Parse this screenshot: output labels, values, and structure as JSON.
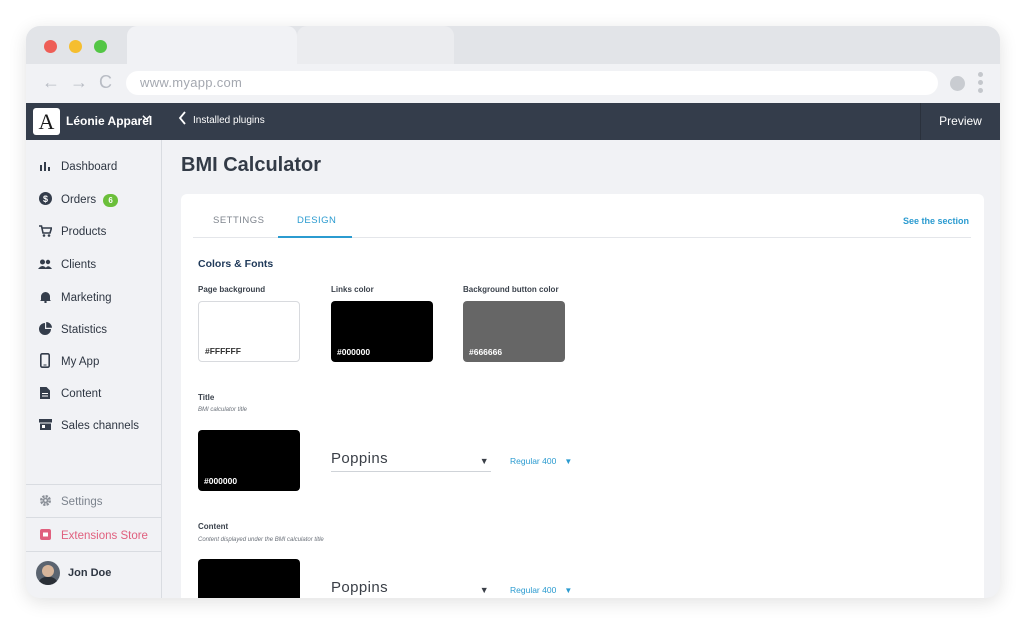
{
  "browser": {
    "url": "www.myapp.com",
    "back_icon": "←",
    "forward_icon": "→",
    "reload_icon": "C"
  },
  "topbar": {
    "logo_letter": "A",
    "store_name": "Léonie Apparel",
    "back_label": "Installed plugins",
    "preview_label": "Preview"
  },
  "sidebar": {
    "items": [
      {
        "label": "Dashboard",
        "icon": "bar-chart-icon"
      },
      {
        "label": "Orders",
        "icon": "dollar-circle-icon",
        "badge": "6"
      },
      {
        "label": "Products",
        "icon": "cart-icon"
      },
      {
        "label": "Clients",
        "icon": "people-icon"
      },
      {
        "label": "Marketing",
        "icon": "bell-icon"
      },
      {
        "label": "Statistics",
        "icon": "pie-chart-icon"
      },
      {
        "label": "My App",
        "icon": "phone-icon"
      },
      {
        "label": "Content",
        "icon": "document-icon"
      },
      {
        "label": "Sales channels",
        "icon": "store-icon"
      }
    ],
    "settings_label": "Settings",
    "extensions_label": "Extensions Store",
    "user_name": "Jon Doe"
  },
  "page": {
    "title": "BMI Calculator",
    "tabs": [
      "SETTINGS",
      "DESIGN"
    ],
    "active_tab": "DESIGN",
    "see_section": "See the section"
  },
  "colors_fonts": {
    "heading": "Colors & Fonts",
    "page_background": {
      "label": "Page background",
      "value": "#FFFFFF"
    },
    "links_color": {
      "label": "Links color",
      "value": "#000000"
    },
    "button_background": {
      "label": "Background button color",
      "value": "#666666"
    }
  },
  "title_field": {
    "label": "Title",
    "sublabel": "BMI calculator title",
    "color": "#000000",
    "font": "Poppins",
    "weight": "Regular 400"
  },
  "content_field": {
    "label": "Content",
    "sublabel": "Content displayed under the BMI calculator title",
    "color": "#000000",
    "font": "Poppins",
    "weight": "Regular 400"
  }
}
